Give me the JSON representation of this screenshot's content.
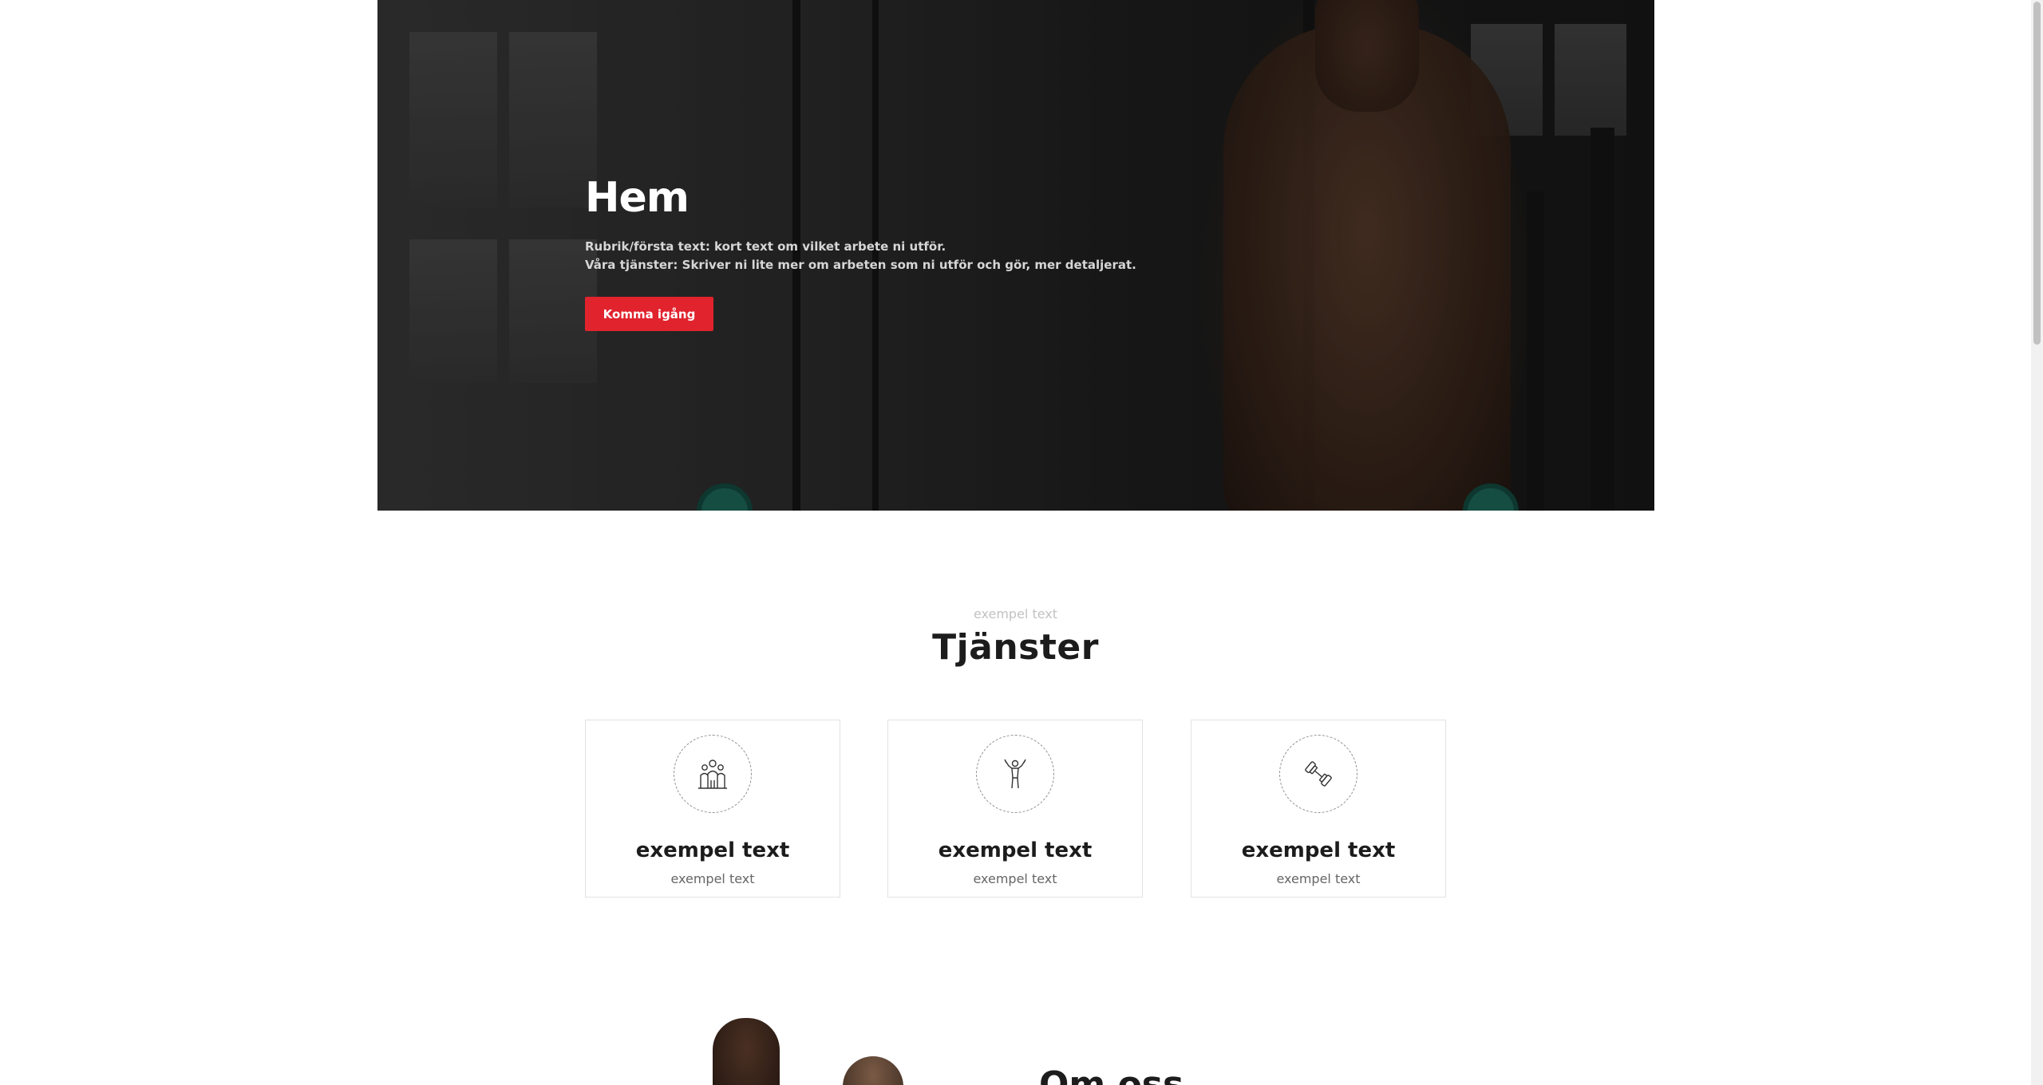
{
  "hero": {
    "title": "Hem",
    "line1": "Rubrik/första text: kort text om vilket arbete ni utför.",
    "line2": "Våra tjänster: Skriver ni lite mer om arbeten som ni utför och gör, mer detaljerat.",
    "cta_label": "Komma igång",
    "cta_color": "#e1232e"
  },
  "services": {
    "eyebrow": "exempel text",
    "title": "Tjänster",
    "cards": [
      {
        "icon": "group-fitness-icon",
        "title": "exempel text",
        "text": "exempel text"
      },
      {
        "icon": "bodybuilder-icon",
        "title": "exempel text",
        "text": "exempel text"
      },
      {
        "icon": "dumbbell-icon",
        "title": "exempel text",
        "text": "exempel text"
      }
    ]
  },
  "about": {
    "title": "Om oss"
  }
}
